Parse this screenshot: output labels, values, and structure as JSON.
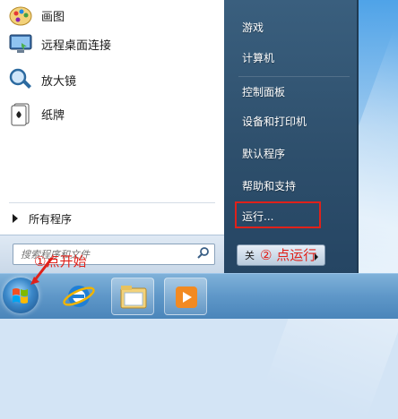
{
  "left_pane": {
    "programs": [
      {
        "label": "画图",
        "icon": "paint-icon"
      },
      {
        "label": "远程桌面连接",
        "icon": "remote-desktop-icon"
      },
      {
        "label": "放大镜",
        "icon": "magnifier-icon"
      },
      {
        "label": "纸牌",
        "icon": "solitaire-icon"
      }
    ],
    "all_programs_label": "所有程序",
    "search_placeholder": "搜索程序和文件"
  },
  "right_pane": {
    "items": [
      "游戏",
      "计算机",
      "控制面板",
      "设备和打印机",
      "默认程序",
      "帮助和支持",
      "运行..."
    ],
    "shutdown_label": "关"
  },
  "annotations": {
    "step1": "①点开始",
    "step2": "②  点运行"
  },
  "taskbar": {
    "apps": [
      "start-orb",
      "internet-explorer-icon",
      "file-explorer-icon",
      "media-player-icon"
    ]
  },
  "colors": {
    "annotation_red": "#e0211a",
    "right_pane": "#2d4e6b",
    "taskbar": "#5e97c8"
  }
}
